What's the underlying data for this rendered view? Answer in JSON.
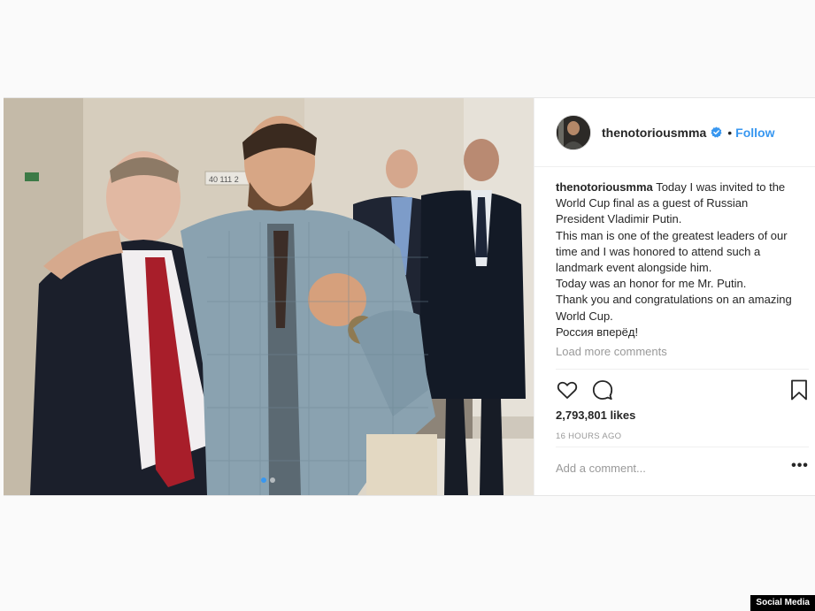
{
  "post": {
    "username": "thenotoriousmma",
    "separator": "•",
    "follow_label": "Follow",
    "media": {
      "carousel_count": 2,
      "active_index": 0,
      "wall_sign_text": "40 111 2"
    },
    "caption": {
      "user": "thenotoriousmma",
      "lines": [
        "Today I was invited to the World Cup final as a guest of Russian President Vladimir Putin.",
        "This man is one of the greatest leaders of our time and I was honored to attend such a landmark event alongside him.",
        "Today was an honor for me Mr. Putin.",
        "Thank you and congratulations on an amazing World Cup.",
        "Россия вперёд!"
      ]
    },
    "load_more_label": "Load more comments",
    "likes": "2,793,801 likes",
    "time_ago": "16 HOURS AGO",
    "comment_placeholder": "Add a comment...",
    "more_options_label": "•••",
    "icons": {
      "like": "heart-icon",
      "comment": "comment-bubble-icon",
      "save": "bookmark-icon",
      "verified": "verified-badge-icon",
      "more": "more-options-icon"
    },
    "colors": {
      "link_blue": "#3897f0",
      "text": "#262626",
      "muted": "#999999",
      "border": "#efefef"
    }
  },
  "watermark": "Social Media"
}
